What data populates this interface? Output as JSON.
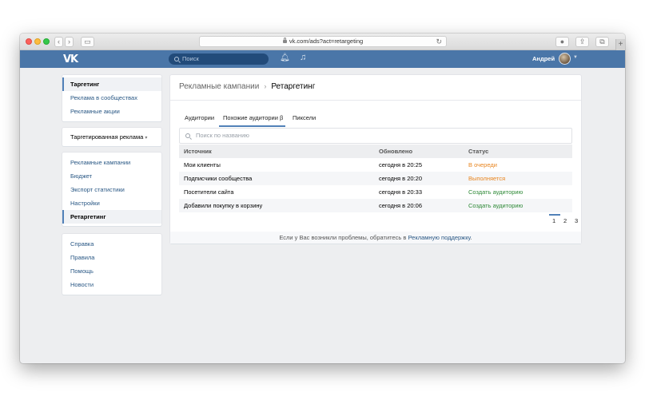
{
  "browser": {
    "url": "vk.com/ads?act=retargeting"
  },
  "vk_header": {
    "logo": "VK",
    "search_placeholder": "Поиск",
    "user_name": "Андрей"
  },
  "sidebar": {
    "group1": [
      {
        "label": "Таргетинг",
        "active": true
      },
      {
        "label": "Реклама в сообществах"
      },
      {
        "label": "Рекламные акции"
      }
    ],
    "account_selector": "Таргетированная реклама",
    "group2": [
      {
        "label": "Рекламные кампании"
      },
      {
        "label": "Бюджет"
      },
      {
        "label": "Экспорт статистики"
      },
      {
        "label": "Настройки"
      },
      {
        "label": "Ретаргетинг",
        "active": true
      }
    ],
    "group3": [
      {
        "label": "Справка"
      },
      {
        "label": "Правила"
      },
      {
        "label": "Помощь"
      },
      {
        "label": "Новости"
      }
    ]
  },
  "breadcrumb": {
    "parent": "Рекламные кампании",
    "current": "Ретаргетинг"
  },
  "tabs": [
    {
      "label": "Аудитории"
    },
    {
      "label": "Похожие аудитории β",
      "selected": true
    },
    {
      "label": "Пиксели"
    }
  ],
  "filter": {
    "placeholder": "Поиск по названию"
  },
  "table": {
    "headers": [
      "Источник",
      "Обновлено",
      "Статус"
    ],
    "rows": [
      {
        "source": "Мои клиенты",
        "updated": "сегодня в 20:25",
        "status": "В очереди"
      },
      {
        "source": "Подписчики сообщества",
        "updated": "сегодня в 20:20",
        "status": "Выполняется"
      },
      {
        "source": "Посетители сайта",
        "updated": "сегодня в 20:33",
        "status": "Создать аудиторию"
      },
      {
        "source": "Добавили покупку в корзину",
        "updated": "сегодня в 20:06",
        "status": "Создать аудиторию"
      }
    ]
  },
  "pagination": {
    "pages": [
      "1",
      "2",
      "3"
    ],
    "current": "1"
  },
  "footer": {
    "text": "Если у Вас возникли проблемы, обратитесь в",
    "link": "Рекламную поддержку",
    "end": "."
  },
  "colors": {
    "header": "#4a76a8",
    "link": "#2a5885",
    "status_orange": "#e8851f",
    "status_green": "#2f8a38"
  }
}
